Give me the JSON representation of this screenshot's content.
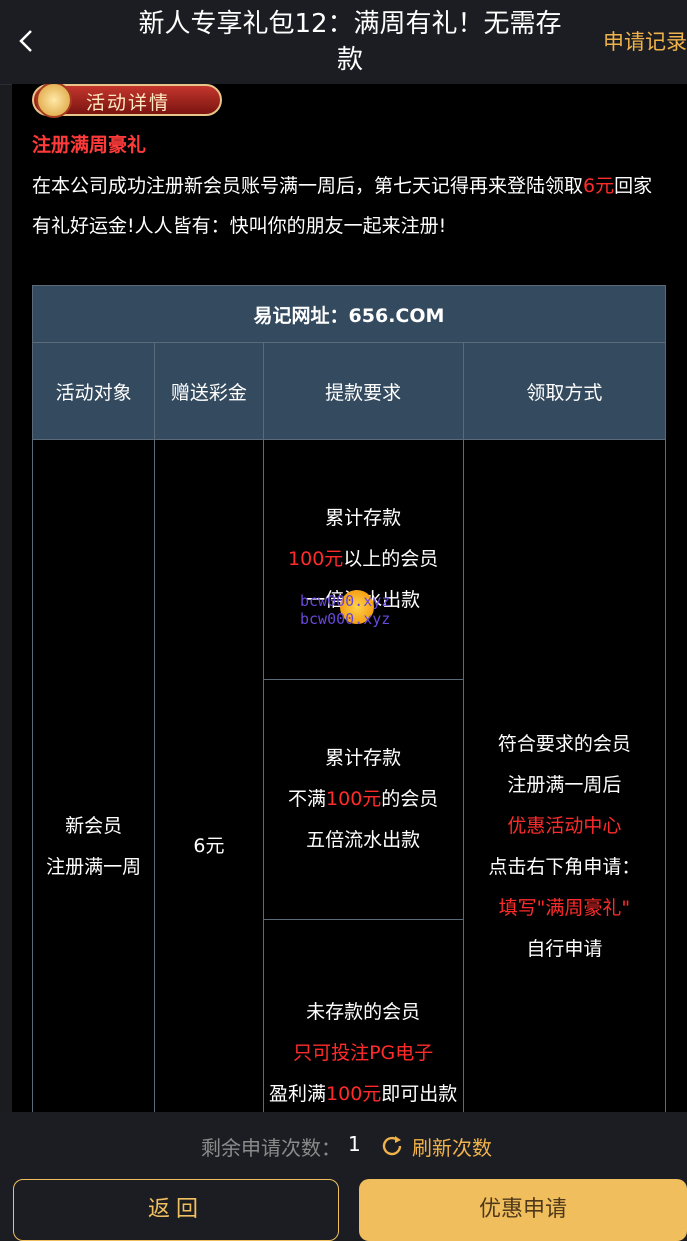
{
  "header": {
    "title": "新人专享礼包12：满周有礼！无需存款",
    "record_label": "申请记录"
  },
  "detail": {
    "badge_label": "活动详情",
    "section_title": "注册满周豪礼",
    "intro_parts": [
      "在本公司成功注册新会员账号满一周后，第七天记得再来登陆领取",
      "6元",
      "回家有礼好运金!人人皆有：快叫你的朋友一起来注册!"
    ]
  },
  "table": {
    "site": "易记网址：656.COM",
    "headers": [
      "活动对象",
      "赠送彩金",
      "提款要求",
      "领取方式"
    ],
    "target": [
      "新会员",
      "注册满一周"
    ],
    "bonus": "6元",
    "req1": [
      "累计存款",
      "100元",
      "以上的会员",
      "一倍流水出款"
    ],
    "req2": [
      "累计存款",
      "不满",
      "100元",
      "的会员",
      "五倍流水出款"
    ],
    "req3": [
      "未存款的会员",
      "只可投注PG电子",
      "盈利满",
      "100元",
      "即可出款"
    ],
    "claim": [
      "符合要求的会员",
      "注册满一周后",
      "优惠活动中心",
      "点击右下角申请：",
      "填写\"满周豪礼\"",
      "自行申请"
    ]
  },
  "watermark": [
    "bcw000.xyz",
    "bcw000.xyz"
  ],
  "footer": {
    "remain_label": "剩余申请次数：",
    "remain_count": "1",
    "refresh_label": "刷新次数",
    "back_label": "返回",
    "apply_label": "优惠申请"
  },
  "colors": {
    "accent": "#f0b24a",
    "highlight": "#ff2b2b",
    "table_header": "#344a5f"
  }
}
